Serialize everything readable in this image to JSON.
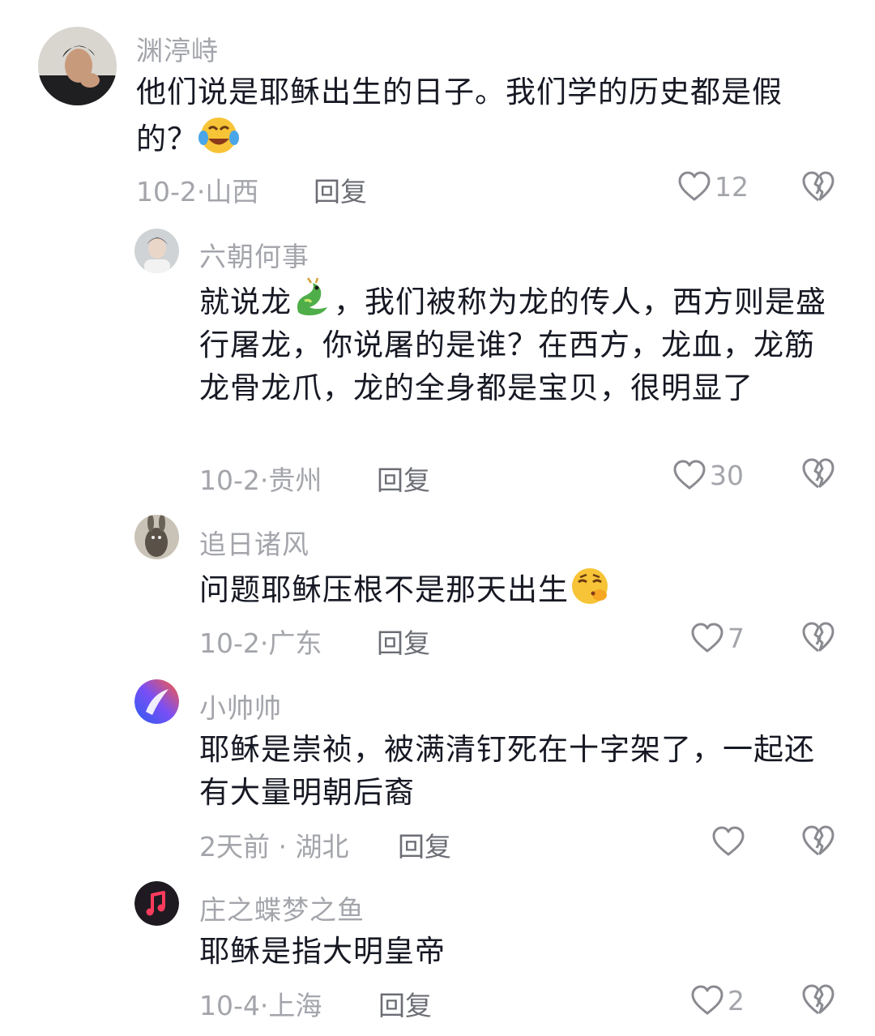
{
  "comments": [
    {
      "username": "渊渟峙",
      "text_before": "他们说是耶稣出生的日子。我们学的历史都是假的？",
      "emoji": "face-with-tears-of-joy",
      "date": "10-2",
      "location": "山西",
      "reply_label": "回复",
      "likes": "12"
    },
    {
      "username": "六朝何事",
      "text_before": "就说龙",
      "emoji": "dragon",
      "text_after": "，我们被称为龙的传人，西方则是盛行屠龙，你说屠的是谁？在西方，龙血，龙筋龙骨龙爪，龙的全身都是宝贝，很明显了",
      "date": "10-2",
      "location": "贵州",
      "reply_label": "回复",
      "likes": "30"
    },
    {
      "username": "追日诸风",
      "text_before": "问题耶稣压根不是那天出生",
      "emoji": "face-exhaling",
      "date": "10-2",
      "location": "广东",
      "reply_label": "回复",
      "likes": "7"
    },
    {
      "username": "小帅帅",
      "text_before": "耶稣是崇祯，被满清钉死在十字架了，一起还有大量明朝后裔",
      "date": "2天前",
      "location": "湖北",
      "reply_label": "回复",
      "likes": ""
    },
    {
      "username": "庄之蝶梦之鱼",
      "text_before": "耶稣是指大明皇帝",
      "date": "10-4",
      "location": "上海",
      "reply_label": "回复",
      "likes": "2"
    }
  ],
  "colors": {
    "text": "#161823",
    "muted": "#a3a5ab",
    "reply": "#6c6e75"
  }
}
